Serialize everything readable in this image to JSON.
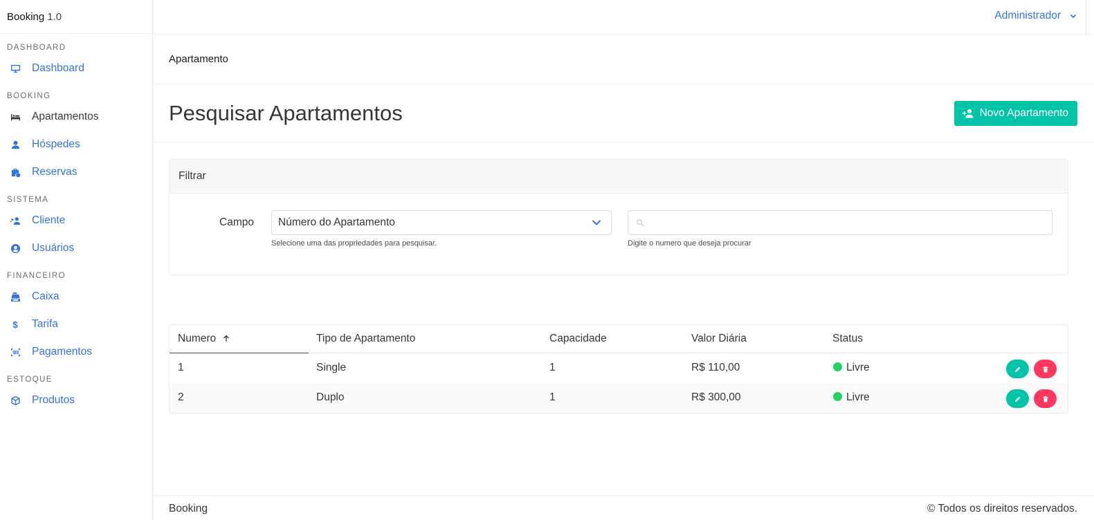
{
  "brand": {
    "name": "Booking",
    "version": "1.0"
  },
  "sidebar": {
    "sections": [
      {
        "label": "DASHBOARD",
        "items": [
          {
            "label": "Dashboard",
            "icon": "monitor-icon",
            "active": false
          }
        ]
      },
      {
        "label": "BOOKING",
        "items": [
          {
            "label": "Apartamentos",
            "icon": "bed-icon",
            "active": true
          },
          {
            "label": "Hóspedes",
            "icon": "user-icon",
            "active": false
          },
          {
            "label": "Reservas",
            "icon": "suitcase-clock-icon",
            "active": false
          }
        ]
      },
      {
        "label": "SISTEMA",
        "items": [
          {
            "label": "Cliente",
            "icon": "users-icon",
            "active": false
          },
          {
            "label": "Usuários",
            "icon": "user-circle-icon",
            "active": false
          }
        ]
      },
      {
        "label": "FINANCEIRO",
        "items": [
          {
            "label": "Caixa",
            "icon": "cash-register-icon",
            "active": false
          },
          {
            "label": "Tarifa",
            "icon": "dollar-icon",
            "active": false
          },
          {
            "label": "Pagamentos",
            "icon": "barcode-icon",
            "active": false
          }
        ]
      },
      {
        "label": "ESTOQUE",
        "items": [
          {
            "label": "Produtos",
            "icon": "box-icon",
            "active": false
          }
        ]
      }
    ]
  },
  "topbar": {
    "user": "Administrador"
  },
  "breadcrumb": "Apartamento",
  "page": {
    "title": "Pesquisar Apartamentos",
    "new_button": "Novo Apartamento"
  },
  "filter": {
    "title": "Filtrar",
    "field_label": "Campo",
    "select_value": "Número do Apartamento",
    "select_help": "Selecione uma das propriedades para pesquisar.",
    "search_value": "",
    "search_help": "Digite o numero que deseja procurar"
  },
  "table": {
    "columns": [
      "Numero",
      "Tipo de Apartamento",
      "Capacidade",
      "Valor Diária",
      "Status"
    ],
    "rows": [
      {
        "numero": "1",
        "tipo": "Single",
        "capacidade": "1",
        "valor": "R$ 110,00",
        "status": "Livre"
      },
      {
        "numero": "2",
        "tipo": "Duplo",
        "capacidade": "1",
        "valor": "R$ 300,00",
        "status": "Livre"
      }
    ]
  },
  "footer": {
    "left": "Booking",
    "right": "© Todos os direitos reservados."
  },
  "colors": {
    "link": "#3273dc",
    "primary": "#00c4a7",
    "danger": "#ff3860",
    "success": "#23d160"
  }
}
